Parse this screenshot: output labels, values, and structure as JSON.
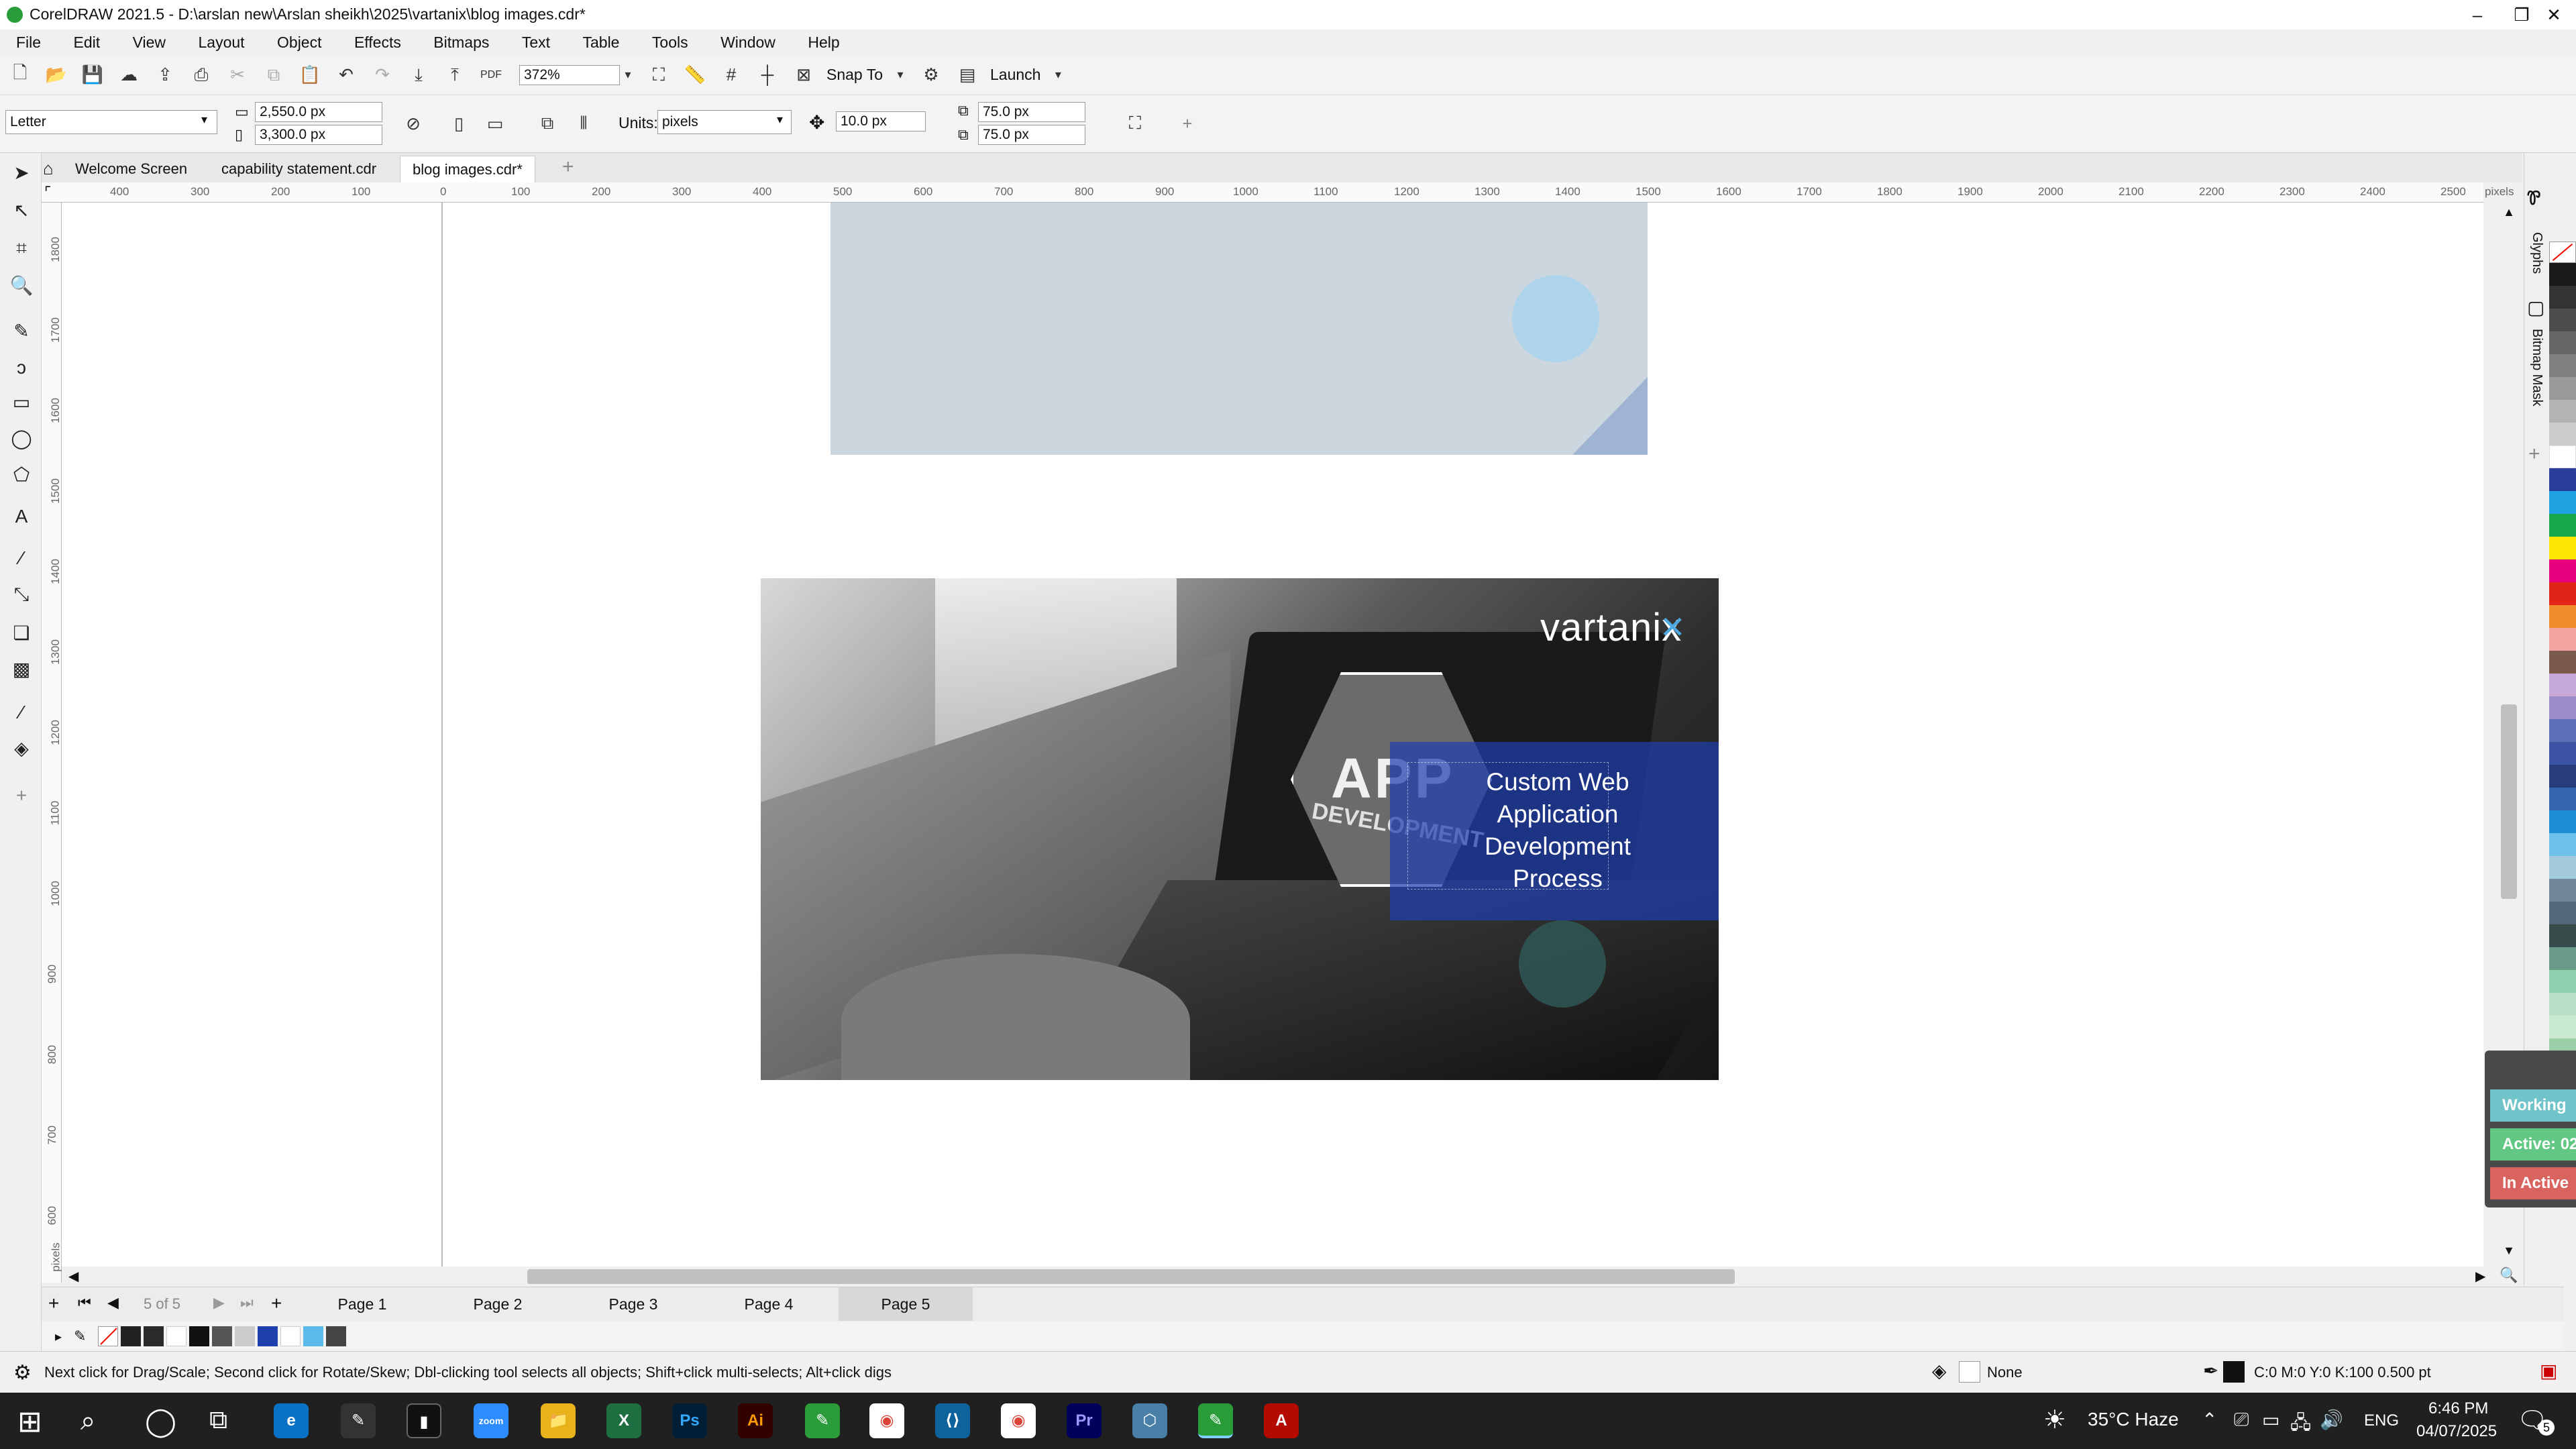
{
  "app": {
    "title": "CorelDRAW 2021.5 - D:\\arslan new\\Arslan sheikh\\2025\\vartanix\\blog images.cdr*",
    "win_minimize": "–",
    "win_restore": "❐",
    "win_close": "✕"
  },
  "menu": [
    "File",
    "Edit",
    "View",
    "Layout",
    "Object",
    "Effects",
    "Bitmaps",
    "Text",
    "Table",
    "Tools",
    "Window",
    "Help"
  ],
  "toolbar1": {
    "zoom": "372%",
    "snap_label": "Snap To",
    "launch_label": "Launch"
  },
  "toolbar2": {
    "page_size": "Letter",
    "width": "2,550.0 px",
    "height": "3,300.0 px",
    "units_label": "Units:",
    "units_value": "pixels",
    "nudge": "10.0 px",
    "dup_x": "75.0 px",
    "dup_y": "75.0 px"
  },
  "tabs": [
    {
      "label": "Welcome Screen"
    },
    {
      "label": "capability statement.cdr"
    },
    {
      "label": "blog images.cdr*"
    }
  ],
  "ruler_h": [
    "400",
    "300",
    "200",
    "100",
    "0",
    "100",
    "200",
    "300",
    "400",
    "500",
    "600",
    "700",
    "800",
    "900",
    "1000",
    "1100",
    "1200",
    "1300",
    "1400",
    "1500",
    "1600",
    "1700",
    "1800",
    "1900",
    "2000",
    "2100",
    "2200",
    "2300",
    "2400",
    "2500"
  ],
  "ruler_h_unit": "pixels",
  "ruler_v": [
    "1800",
    "1700",
    "1600",
    "1500",
    "1400",
    "1300",
    "1200",
    "1100",
    "1000",
    "900",
    "800",
    "700",
    "600"
  ],
  "ruler_v_unit": "pixels",
  "artwork": {
    "brand": "vartanix",
    "overlay_text": "Custom Web Application Development Process",
    "screen_text_1": "APP",
    "screen_text_2": "DEVELOPMENT"
  },
  "right_panel": {
    "docker_tab_1": "Glyphs",
    "docker_tab_2": "Bitmap Mask",
    "widget_1": "Working",
    "widget_2": "Active: 02",
    "widget_3": "In Active"
  },
  "page_nav": {
    "counter": "5 of 5",
    "pages": [
      "Page 1",
      "Page 2",
      "Page 3",
      "Page 4",
      "Page 5"
    ],
    "active_page": "Page 5"
  },
  "status": {
    "hint": "Next click for Drag/Scale; Second click for Rotate/Skew; Dbl-clicking tool selects all objects; Shift+click multi-selects; Alt+click digs",
    "fill": "None",
    "outline": "C:0 M:0 Y:0 K:100  0.500 pt"
  },
  "taskbar": {
    "weather": "35°C Haze",
    "lang": "ENG",
    "time": "6:46 PM",
    "date": "04/07/2025",
    "notif": "5",
    "apps": [
      "zoom",
      "Ps",
      "Ai",
      "Pr"
    ]
  },
  "colors": {
    "accent_blue": "#1e3fae",
    "page_gray": "#ccd6de",
    "widget_working": "#6fc3c9",
    "widget_active": "#62c783",
    "widget_inactive": "#d9635e"
  }
}
